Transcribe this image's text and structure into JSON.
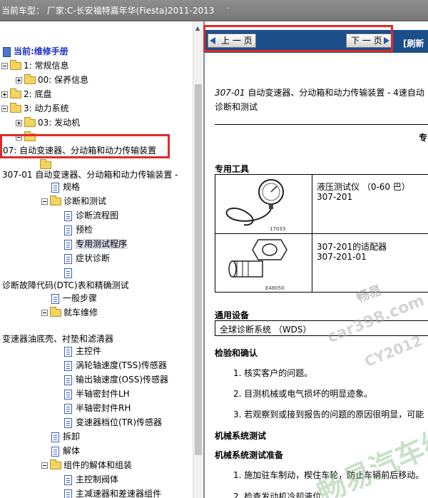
{
  "topbar": {
    "title": "当前车型：  厂家:C-长安福特嘉年华(Fiesta)2011-2013",
    "marker": "."
  },
  "tree": {
    "root_label": "当前:维修手册",
    "items": [
      {
        "label": "1: 常规信息"
      },
      {
        "label": "00: 保养信息"
      },
      {
        "label": "2: 底盘"
      },
      {
        "label": "3: 动力系统"
      },
      {
        "label": "03: 发动机"
      },
      {
        "label": "07: 自动变速器、分动箱和动力传输装置"
      },
      {
        "label": "307-01 自动变速器、分动箱和动力传输装置 -"
      },
      {
        "label": "规格"
      },
      {
        "label": "诊断和测试"
      },
      {
        "label": "诊断流程图"
      },
      {
        "label": "预检"
      },
      {
        "label": "专用测试程序"
      },
      {
        "label": "症状诊断"
      },
      {
        "label": ""
      },
      {
        "label": "诊断故障代码(DTC)表和精确测试"
      },
      {
        "label": "一般步骤"
      },
      {
        "label": "就车维修"
      },
      {
        "label": "变速器油底壳、衬垫和滤清器"
      },
      {
        "label": "主控件"
      },
      {
        "label": "涡轮轴速度(TSS)传感器"
      },
      {
        "label": "输出轴速度(OSS)传感器"
      },
      {
        "label": "半轴密封件LH"
      },
      {
        "label": "半轴密封件RH"
      },
      {
        "label": "变速器档位(TR)传感器"
      },
      {
        "label": "拆卸"
      },
      {
        "label": "解体"
      },
      {
        "label": "组件的解体和组装"
      },
      {
        "label": "主控制阀体"
      },
      {
        "label": "主减速器和差速器组件"
      }
    ]
  },
  "nav": {
    "prev_label": "上 一 页",
    "next_label": "下 一 页",
    "refresh_label": "[刷新"
  },
  "document": {
    "heading_line1_code": "307-01",
    "heading_line1_rest": " 自动变速器、分动箱和动力传输装置 - 4速自动",
    "heading_line2": "诊断和测试",
    "right_fragment": "专",
    "special_tools_title": "专用工具",
    "tools": [
      {
        "name": "液压测试仪 （0-60 巴）",
        "code": "307-201",
        "image_caption": "17033"
      },
      {
        "name": "307-201的适配器",
        "code": "307-201-01",
        "image_caption": "E48050"
      }
    ],
    "general_equipment_title": "通用设备",
    "wds_label": "全球诊断系统 （WDS）",
    "inspection_title": "检验和确认",
    "inspection_steps": [
      "1. 核实客户的问题。",
      "2. 目测机械或电气损坏的明显迹象。",
      "3. 若观察到或接到报告的问题的原因很明显，可能"
    ],
    "mech_test_title": "机械系统测试",
    "mech_prep_title": "机械系统测试准备",
    "mech_steps": [
      "1. 施加驻车制动，楔住车轮，防止车辆前后移动。",
      "2. 检查发动机冷却液位"
    ]
  },
  "watermarks": {
    "line1": "畅易",
    "line2": "car398.com",
    "line3": "CY2012",
    "line4": "畅易汽车维"
  },
  "colors": {
    "highlight_red": "#e02a2a",
    "nav_blue": "#1c4f8a",
    "tree_blue": "#1a2fbf"
  }
}
